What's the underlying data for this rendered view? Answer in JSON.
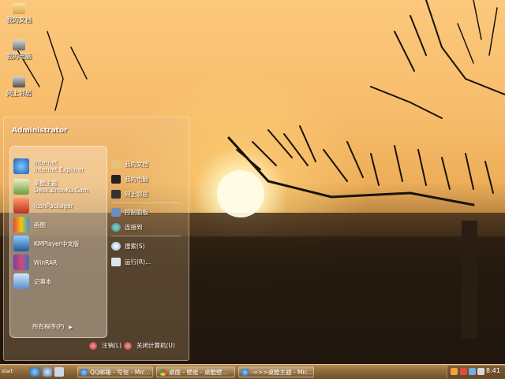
{
  "desktop": {
    "icons": [
      {
        "label": "我的文档",
        "icon": "my-documents-icon"
      },
      {
        "label": "我的电脑",
        "icon": "my-computer-icon"
      },
      {
        "label": "网上邻居",
        "icon": "network-icon"
      }
    ]
  },
  "start_menu": {
    "user_name": "Administrator",
    "pinned": [
      {
        "line1": "Internet",
        "line2": "Internet Explorer",
        "icon": "internet-explorer-icon"
      },
      {
        "line1": "桌酷主题",
        "line2": "Desk.ZhuoKu.Com",
        "icon": "zhuoku-icon"
      },
      {
        "line1": "IconPackager",
        "line2": "",
        "icon": "iconpackager-icon"
      },
      {
        "line1": "画图",
        "line2": "",
        "icon": "paint-icon"
      },
      {
        "line1": "KMPlayer中文版",
        "line2": "",
        "icon": "kmplayer-icon"
      },
      {
        "line1": "WinRAR",
        "line2": "",
        "icon": "winrar-icon"
      },
      {
        "line1": "记事本",
        "line2": "",
        "icon": "notepad-icon"
      }
    ],
    "all_programs": "所有程序(P)",
    "right": [
      {
        "label": "我的文档",
        "icon": "documents-icon"
      },
      {
        "label": "我的电脑",
        "icon": "computer-icon"
      },
      {
        "label": "网上邻居",
        "icon": "network-places-icon"
      },
      {
        "label": "控制面板",
        "icon": "control-panel-icon"
      },
      {
        "label": "连接到",
        "icon": "connect-to-icon"
      },
      {
        "label": "搜索(S)",
        "icon": "search-icon"
      },
      {
        "label": "运行(R)...",
        "icon": "run-icon"
      }
    ],
    "logoff": "注销(L)",
    "shutdown": "关闭计算机(U)"
  },
  "taskbar": {
    "start_label": "start",
    "tasks": [
      {
        "label": "QQ邮箱 - 写信 - Mic...",
        "icon": "ie-icon"
      },
      {
        "label": "桌面 - 壁纸 - 桌酷壁...",
        "icon": "chrome-icon"
      },
      {
        "label": "-=>>桌酷主题 - Mic...",
        "icon": "ie-icon"
      }
    ],
    "clock": "8:41"
  },
  "colors": {
    "sky": "#f7bd6c",
    "taskbar": "#8f6a3b"
  }
}
